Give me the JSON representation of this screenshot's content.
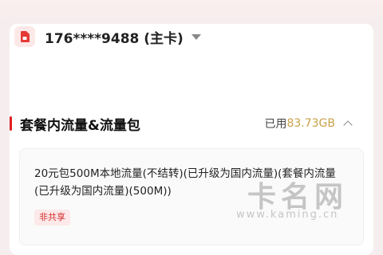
{
  "account": {
    "phone": "176****9488 (主卡)",
    "sim_icon": "sim-card-icon",
    "dropdown_icon": "caret-down-icon"
  },
  "section": {
    "title": "套餐内流量&流量包",
    "used_label": "已用",
    "used_value": "83.73GB",
    "collapse_icon": "chevron-up-icon",
    "accent_color": "#e02020"
  },
  "package": {
    "name": "20元包500M本地流量(不结转)(已升级为国内流量)(套餐内流量(已升级为国内流量)(500M))",
    "tag": "非共享"
  },
  "watermark": {
    "text_cn": "卡名网",
    "url": "www.kaming.cn"
  }
}
